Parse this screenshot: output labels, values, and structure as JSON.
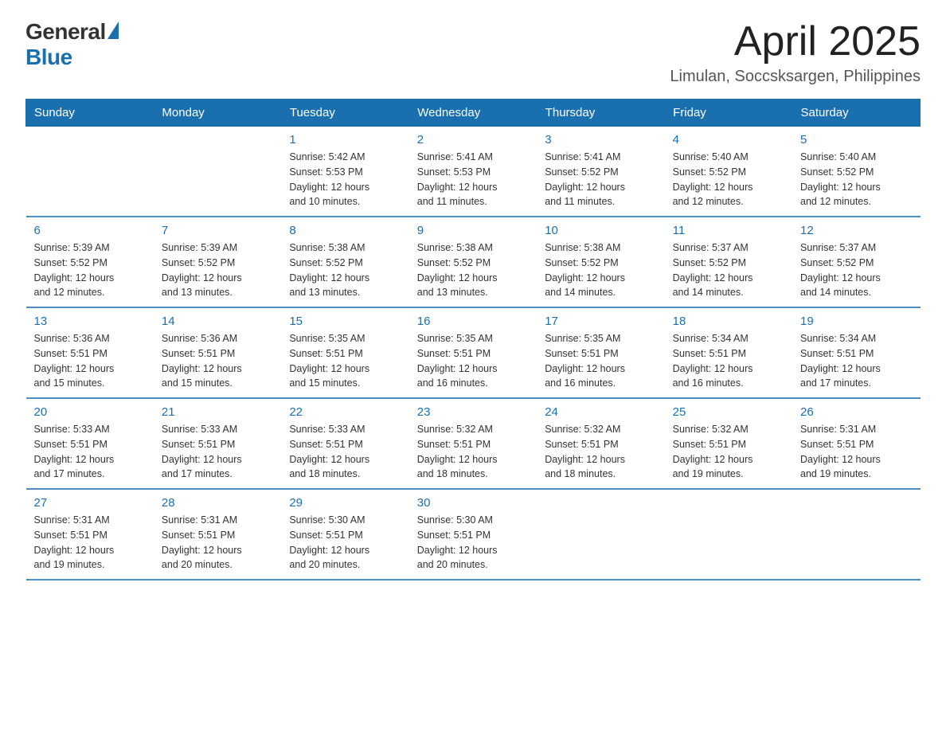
{
  "logo": {
    "general": "General",
    "blue": "Blue"
  },
  "header": {
    "title": "April 2025",
    "subtitle": "Limulan, Soccsksargen, Philippines"
  },
  "weekdays": [
    "Sunday",
    "Monday",
    "Tuesday",
    "Wednesday",
    "Thursday",
    "Friday",
    "Saturday"
  ],
  "weeks": [
    [
      {
        "day": "",
        "info": ""
      },
      {
        "day": "",
        "info": ""
      },
      {
        "day": "1",
        "info": "Sunrise: 5:42 AM\nSunset: 5:53 PM\nDaylight: 12 hours\nand 10 minutes."
      },
      {
        "day": "2",
        "info": "Sunrise: 5:41 AM\nSunset: 5:53 PM\nDaylight: 12 hours\nand 11 minutes."
      },
      {
        "day": "3",
        "info": "Sunrise: 5:41 AM\nSunset: 5:52 PM\nDaylight: 12 hours\nand 11 minutes."
      },
      {
        "day": "4",
        "info": "Sunrise: 5:40 AM\nSunset: 5:52 PM\nDaylight: 12 hours\nand 12 minutes."
      },
      {
        "day": "5",
        "info": "Sunrise: 5:40 AM\nSunset: 5:52 PM\nDaylight: 12 hours\nand 12 minutes."
      }
    ],
    [
      {
        "day": "6",
        "info": "Sunrise: 5:39 AM\nSunset: 5:52 PM\nDaylight: 12 hours\nand 12 minutes."
      },
      {
        "day": "7",
        "info": "Sunrise: 5:39 AM\nSunset: 5:52 PM\nDaylight: 12 hours\nand 13 minutes."
      },
      {
        "day": "8",
        "info": "Sunrise: 5:38 AM\nSunset: 5:52 PM\nDaylight: 12 hours\nand 13 minutes."
      },
      {
        "day": "9",
        "info": "Sunrise: 5:38 AM\nSunset: 5:52 PM\nDaylight: 12 hours\nand 13 minutes."
      },
      {
        "day": "10",
        "info": "Sunrise: 5:38 AM\nSunset: 5:52 PM\nDaylight: 12 hours\nand 14 minutes."
      },
      {
        "day": "11",
        "info": "Sunrise: 5:37 AM\nSunset: 5:52 PM\nDaylight: 12 hours\nand 14 minutes."
      },
      {
        "day": "12",
        "info": "Sunrise: 5:37 AM\nSunset: 5:52 PM\nDaylight: 12 hours\nand 14 minutes."
      }
    ],
    [
      {
        "day": "13",
        "info": "Sunrise: 5:36 AM\nSunset: 5:51 PM\nDaylight: 12 hours\nand 15 minutes."
      },
      {
        "day": "14",
        "info": "Sunrise: 5:36 AM\nSunset: 5:51 PM\nDaylight: 12 hours\nand 15 minutes."
      },
      {
        "day": "15",
        "info": "Sunrise: 5:35 AM\nSunset: 5:51 PM\nDaylight: 12 hours\nand 15 minutes."
      },
      {
        "day": "16",
        "info": "Sunrise: 5:35 AM\nSunset: 5:51 PM\nDaylight: 12 hours\nand 16 minutes."
      },
      {
        "day": "17",
        "info": "Sunrise: 5:35 AM\nSunset: 5:51 PM\nDaylight: 12 hours\nand 16 minutes."
      },
      {
        "day": "18",
        "info": "Sunrise: 5:34 AM\nSunset: 5:51 PM\nDaylight: 12 hours\nand 16 minutes."
      },
      {
        "day": "19",
        "info": "Sunrise: 5:34 AM\nSunset: 5:51 PM\nDaylight: 12 hours\nand 17 minutes."
      }
    ],
    [
      {
        "day": "20",
        "info": "Sunrise: 5:33 AM\nSunset: 5:51 PM\nDaylight: 12 hours\nand 17 minutes."
      },
      {
        "day": "21",
        "info": "Sunrise: 5:33 AM\nSunset: 5:51 PM\nDaylight: 12 hours\nand 17 minutes."
      },
      {
        "day": "22",
        "info": "Sunrise: 5:33 AM\nSunset: 5:51 PM\nDaylight: 12 hours\nand 18 minutes."
      },
      {
        "day": "23",
        "info": "Sunrise: 5:32 AM\nSunset: 5:51 PM\nDaylight: 12 hours\nand 18 minutes."
      },
      {
        "day": "24",
        "info": "Sunrise: 5:32 AM\nSunset: 5:51 PM\nDaylight: 12 hours\nand 18 minutes."
      },
      {
        "day": "25",
        "info": "Sunrise: 5:32 AM\nSunset: 5:51 PM\nDaylight: 12 hours\nand 19 minutes."
      },
      {
        "day": "26",
        "info": "Sunrise: 5:31 AM\nSunset: 5:51 PM\nDaylight: 12 hours\nand 19 minutes."
      }
    ],
    [
      {
        "day": "27",
        "info": "Sunrise: 5:31 AM\nSunset: 5:51 PM\nDaylight: 12 hours\nand 19 minutes."
      },
      {
        "day": "28",
        "info": "Sunrise: 5:31 AM\nSunset: 5:51 PM\nDaylight: 12 hours\nand 20 minutes."
      },
      {
        "day": "29",
        "info": "Sunrise: 5:30 AM\nSunset: 5:51 PM\nDaylight: 12 hours\nand 20 minutes."
      },
      {
        "day": "30",
        "info": "Sunrise: 5:30 AM\nSunset: 5:51 PM\nDaylight: 12 hours\nand 20 minutes."
      },
      {
        "day": "",
        "info": ""
      },
      {
        "day": "",
        "info": ""
      },
      {
        "day": "",
        "info": ""
      }
    ]
  ]
}
